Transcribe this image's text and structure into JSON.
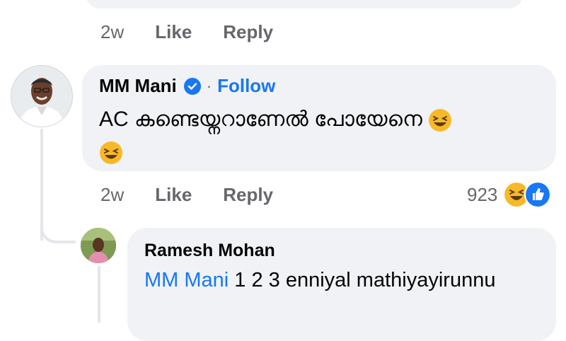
{
  "previous_comment": {
    "time": "2w",
    "like_label": "Like",
    "reply_label": "Reply"
  },
  "comment": {
    "author": "MM Mani",
    "separator": "·",
    "follow_label": "Follow",
    "text": "AC കണ്ടെയ്നറാണേൽ പോയേനെ",
    "time": "2w",
    "like_label": "Like",
    "reply_label": "Reply",
    "reaction_count": "923",
    "reactions": [
      "laughing-emoji",
      "like-reaction"
    ]
  },
  "reply": {
    "author": "Ramesh Mohan",
    "mention": "MM Mani",
    "text": " 1 2 3 enniyal mathiyayirunnu"
  },
  "colors": {
    "accent": "#1877f2",
    "bubble": "#f0f2f5",
    "muted_text": "#65676b",
    "reaction_yellow": "#f7b928"
  }
}
